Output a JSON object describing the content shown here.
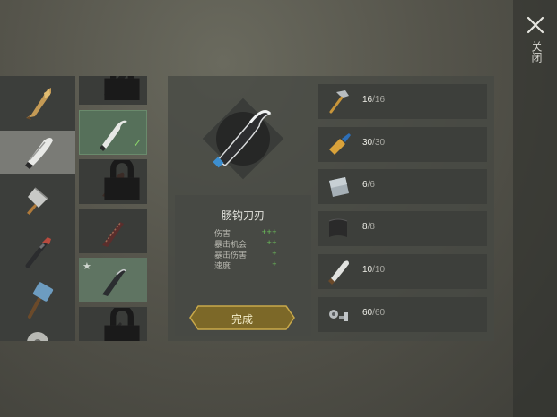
{
  "header": {
    "close_label": "关闭"
  },
  "categories": [
    {
      "icon": "wooden-club-icon"
    },
    {
      "icon": "machete-icon"
    },
    {
      "icon": "cleaver-icon"
    },
    {
      "icon": "crowbar-icon"
    },
    {
      "icon": "sledgehammer-icon"
    },
    {
      "icon": "saw-blade-icon"
    }
  ],
  "recipes": [
    {
      "icon": "blade-icon",
      "locked": true
    },
    {
      "icon": "hook-blade-icon",
      "crafted": true,
      "selected": true
    },
    {
      "icon": "rusty-blade-icon",
      "locked": true
    },
    {
      "icon": "spiked-blade-icon",
      "locked": false
    },
    {
      "icon": "curved-blade-icon",
      "favorite": true
    },
    {
      "icon": "dark-blade-icon",
      "locked": true
    }
  ],
  "item": {
    "name": "肠钩刀刃",
    "icon": "hook-blade-icon",
    "stats": [
      {
        "label": "伤害",
        "rating": "+++"
      },
      {
        "label": "暴击机会",
        "rating": "++"
      },
      {
        "label": "暴击伤害",
        "rating": "+"
      },
      {
        "label": "速度",
        "rating": "+"
      }
    ],
    "action_label": "完成"
  },
  "materials": [
    {
      "icon": "hammer-icon",
      "have": "16",
      "need": "/16"
    },
    {
      "icon": "glue-icon",
      "have": "30",
      "need": "/30"
    },
    {
      "icon": "metal-plate-icon",
      "have": "6",
      "need": "/6"
    },
    {
      "icon": "leather-icon",
      "have": "8",
      "need": "/8"
    },
    {
      "icon": "machete-icon",
      "have": "10",
      "need": "/10"
    },
    {
      "icon": "nuts-bolts-icon",
      "have": "60",
      "need": "/60"
    }
  ],
  "colors": {
    "accent_gold": "#b8973e",
    "check_green": "#8ad46a",
    "plus_green": "#6cc05a"
  }
}
